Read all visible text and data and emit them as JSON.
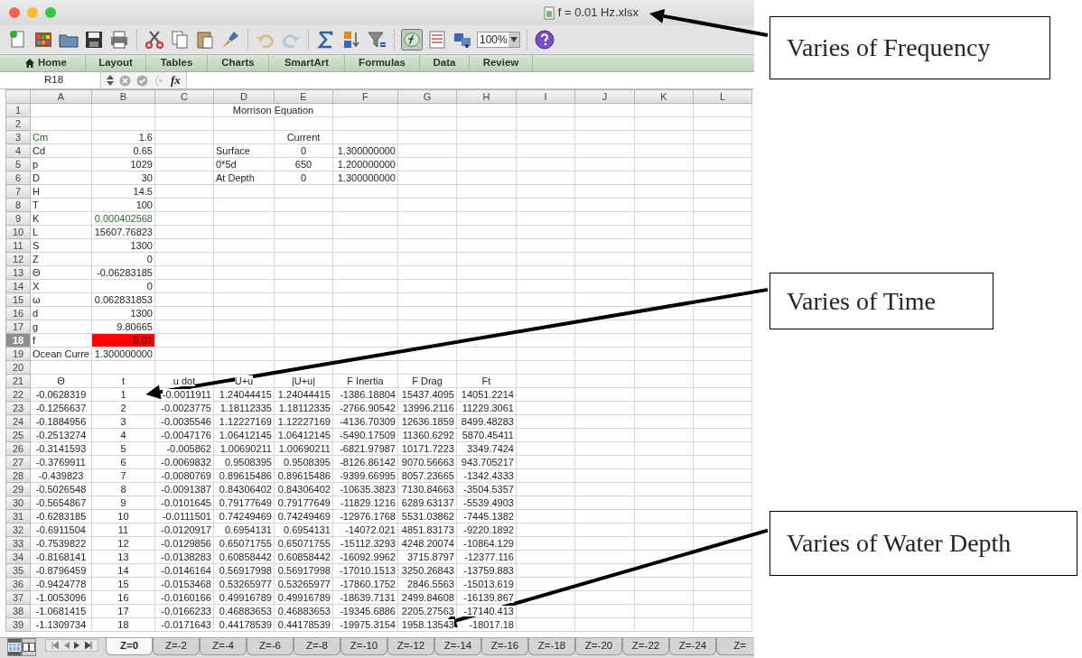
{
  "window": {
    "title": "f = 0.01 Hz.xlsx"
  },
  "toolbar": {
    "zoom": "100%"
  },
  "ribbon_tabs": [
    {
      "label": "Home"
    },
    {
      "label": "Layout"
    },
    {
      "label": "Tables"
    },
    {
      "label": "Charts"
    },
    {
      "label": "SmartArt"
    },
    {
      "label": "Formulas"
    },
    {
      "label": "Data"
    },
    {
      "label": "Review"
    }
  ],
  "formula_bar": {
    "name_box": "R18",
    "fx_label": "fx"
  },
  "columns": [
    "A",
    "B",
    "C",
    "D",
    "E",
    "F",
    "G",
    "H",
    "I",
    "J",
    "K",
    "L"
  ],
  "rows": [
    {
      "number": "1",
      "selected": false,
      "cells": {
        "D": {
          "text": "Morrison Equation",
          "kind": "title"
        }
      }
    },
    {
      "number": "2",
      "selected": false
    },
    {
      "number": "3",
      "selected": false,
      "cells": {
        "A": {
          "text": "Cm",
          "kind": "label",
          "color": "#1e5a1e"
        },
        "B": {
          "text": "1.6",
          "kind": "number"
        },
        "E": {
          "text": "Current",
          "kind": "center"
        }
      }
    },
    {
      "number": "4",
      "selected": false,
      "cells": {
        "A": {
          "text": "Cd",
          "kind": "label"
        },
        "B": {
          "text": "0.65",
          "kind": "number"
        },
        "D": {
          "text": "Surface",
          "kind": "label"
        },
        "E": {
          "text": "0",
          "kind": "center"
        },
        "F": {
          "text": "1.300000000",
          "kind": "number"
        }
      }
    },
    {
      "number": "5",
      "selected": false,
      "cells": {
        "A": {
          "text": "p",
          "kind": "label"
        },
        "B": {
          "text": "1029",
          "kind": "number"
        },
        "D": {
          "text": "0*5d",
          "kind": "label"
        },
        "E": {
          "text": "650",
          "kind": "center"
        },
        "F": {
          "text": "1.200000000",
          "kind": "number"
        }
      }
    },
    {
      "number": "6",
      "selected": false,
      "cells": {
        "A": {
          "text": "D",
          "kind": "label"
        },
        "B": {
          "text": "30",
          "kind": "number"
        },
        "D": {
          "text": "At Depth",
          "kind": "label"
        },
        "E": {
          "text": "0",
          "kind": "center"
        },
        "F": {
          "text": "1.300000000",
          "kind": "number"
        }
      }
    },
    {
      "number": "7",
      "selected": false,
      "cells": {
        "A": {
          "text": "H",
          "kind": "label"
        },
        "B": {
          "text": "14.5",
          "kind": "number"
        }
      }
    },
    {
      "number": "8",
      "selected": false,
      "cells": {
        "A": {
          "text": "T",
          "kind": "label"
        },
        "B": {
          "text": "100",
          "kind": "number"
        }
      }
    },
    {
      "number": "9",
      "selected": false,
      "cells": {
        "A": {
          "text": "K",
          "kind": "label"
        },
        "B": {
          "text": "0.000402568",
          "kind": "number",
          "color": "#2a6e2a"
        }
      }
    },
    {
      "number": "10",
      "selected": false,
      "cells": {
        "A": {
          "text": "L",
          "kind": "label"
        },
        "B": {
          "text": "15607.76823",
          "kind": "number"
        }
      }
    },
    {
      "number": "11",
      "selected": false,
      "cells": {
        "A": {
          "text": "S",
          "kind": "label"
        },
        "B": {
          "text": "1300",
          "kind": "number"
        }
      }
    },
    {
      "number": "12",
      "selected": false,
      "cells": {
        "A": {
          "text": "Z",
          "kind": "label"
        },
        "B": {
          "text": "0",
          "kind": "number"
        }
      }
    },
    {
      "number": "13",
      "selected": false,
      "cells": {
        "A": {
          "text": "Θ",
          "kind": "label"
        },
        "B": {
          "text": "-0.06283185",
          "kind": "number"
        }
      }
    },
    {
      "number": "14",
      "selected": false,
      "cells": {
        "A": {
          "text": "X",
          "kind": "label"
        },
        "B": {
          "text": "0",
          "kind": "number"
        }
      }
    },
    {
      "number": "15",
      "selected": false,
      "cells": {
        "A": {
          "text": "ω",
          "kind": "label"
        },
        "B": {
          "text": "0.062831853",
          "kind": "number"
        }
      }
    },
    {
      "number": "16",
      "selected": false,
      "cells": {
        "A": {
          "text": "d",
          "kind": "label"
        },
        "B": {
          "text": "1300",
          "kind": "number"
        }
      }
    },
    {
      "number": "17",
      "selected": false,
      "cells": {
        "A": {
          "text": "g",
          "kind": "label"
        },
        "B": {
          "text": "9.80665",
          "kind": "number"
        }
      }
    },
    {
      "number": "18",
      "selected": true,
      "cells": {
        "A": {
          "text": "f",
          "kind": "label"
        },
        "B": {
          "text": "0.01",
          "kind": "number",
          "highlighted": true
        }
      }
    },
    {
      "number": "19",
      "selected": false,
      "cells": {
        "A": {
          "text": "Ocean Curre",
          "kind": "label"
        },
        "B": {
          "text": "1.300000000",
          "kind": "number"
        }
      }
    },
    {
      "number": "20",
      "selected": false
    },
    {
      "number": "21",
      "selected": false,
      "cells": {
        "A": {
          "text": "Θ",
          "kind": "center"
        },
        "B": {
          "text": "t",
          "kind": "center"
        },
        "C": {
          "text": "u dot",
          "kind": "center"
        },
        "D": {
          "text": "U+u",
          "kind": "center"
        },
        "E": {
          "text": "|U+u|",
          "kind": "center"
        },
        "F": {
          "text": "F Inertia",
          "kind": "center"
        },
        "G": {
          "text": "F Drag",
          "kind": "center"
        },
        "H": {
          "text": "Ft",
          "kind": "center"
        }
      }
    },
    {
      "number": "22",
      "selected": false,
      "cells": {
        "A": {
          "text": "-0.0628319",
          "kind": "center"
        },
        "B": {
          "text": "1",
          "kind": "center"
        },
        "C": {
          "text": "-0.0011911",
          "kind": "number"
        },
        "D": {
          "text": "1.24044415",
          "kind": "number"
        },
        "E": {
          "text": "1.24044415",
          "kind": "number"
        },
        "F": {
          "text": "-1386.18804",
          "kind": "number"
        },
        "G": {
          "text": "15437.4095",
          "kind": "number"
        },
        "H": {
          "text": "14051.2214",
          "kind": "number"
        }
      }
    },
    {
      "number": "23",
      "selected": false,
      "cells": {
        "A": {
          "text": "-0.1256637",
          "kind": "center"
        },
        "B": {
          "text": "2",
          "kind": "center"
        },
        "C": {
          "text": "-0.0023775",
          "kind": "number"
        },
        "D": {
          "text": "1.18112335",
          "kind": "number"
        },
        "E": {
          "text": "1.18112335",
          "kind": "number"
        },
        "F": {
          "text": "-2766.90542",
          "kind": "number"
        },
        "G": {
          "text": "13996.2116",
          "kind": "number"
        },
        "H": {
          "text": "11229.3061",
          "kind": "number"
        }
      }
    },
    {
      "number": "24",
      "selected": false,
      "cells": {
        "A": {
          "text": "-0.1884956",
          "kind": "center"
        },
        "B": {
          "text": "3",
          "kind": "center"
        },
        "C": {
          "text": "-0.0035546",
          "kind": "number"
        },
        "D": {
          "text": "1.12227169",
          "kind": "number"
        },
        "E": {
          "text": "1.12227169",
          "kind": "number"
        },
        "F": {
          "text": "-4136.70309",
          "kind": "number"
        },
        "G": {
          "text": "12636.1859",
          "kind": "number"
        },
        "H": {
          "text": "8499.48283",
          "kind": "number"
        }
      }
    },
    {
      "number": "25",
      "selected": false,
      "cells": {
        "A": {
          "text": "-0.2513274",
          "kind": "center"
        },
        "B": {
          "text": "4",
          "kind": "center"
        },
        "C": {
          "text": "-0.0047176",
          "kind": "number"
        },
        "D": {
          "text": "1.06412145",
          "kind": "number"
        },
        "E": {
          "text": "1.06412145",
          "kind": "number"
        },
        "F": {
          "text": "-5490.17509",
          "kind": "number"
        },
        "G": {
          "text": "11360.6292",
          "kind": "number"
        },
        "H": {
          "text": "5870.45411",
          "kind": "number"
        }
      }
    },
    {
      "number": "26",
      "selected": false,
      "cells": {
        "A": {
          "text": "-0.3141593",
          "kind": "center"
        },
        "B": {
          "text": "5",
          "kind": "center"
        },
        "C": {
          "text": "-0.005862",
          "kind": "number"
        },
        "D": {
          "text": "1.00690211",
          "kind": "number"
        },
        "E": {
          "text": "1.00690211",
          "kind": "number"
        },
        "F": {
          "text": "-6821.97987",
          "kind": "number"
        },
        "G": {
          "text": "10171.7223",
          "kind": "number"
        },
        "H": {
          "text": "3349.7424",
          "kind": "number"
        }
      }
    },
    {
      "number": "27",
      "selected": false,
      "cells": {
        "A": {
          "text": "-0.3769911",
          "kind": "center"
        },
        "B": {
          "text": "6",
          "kind": "center"
        },
        "C": {
          "text": "-0.0069832",
          "kind": "number"
        },
        "D": {
          "text": "0.9508395",
          "kind": "number"
        },
        "E": {
          "text": "0.9508395",
          "kind": "number"
        },
        "F": {
          "text": "-8126.86142",
          "kind": "number"
        },
        "G": {
          "text": "9070.56663",
          "kind": "number"
        },
        "H": {
          "text": "943.705217",
          "kind": "number"
        }
      }
    },
    {
      "number": "28",
      "selected": false,
      "cells": {
        "A": {
          "text": "-0.439823",
          "kind": "center"
        },
        "B": {
          "text": "7",
          "kind": "center"
        },
        "C": {
          "text": "-0.0080769",
          "kind": "number"
        },
        "D": {
          "text": "0.89615486",
          "kind": "number"
        },
        "E": {
          "text": "0.89615486",
          "kind": "number"
        },
        "F": {
          "text": "-9399.66995",
          "kind": "number"
        },
        "G": {
          "text": "8057.23665",
          "kind": "number"
        },
        "H": {
          "text": "-1342.4333",
          "kind": "number"
        }
      }
    },
    {
      "number": "29",
      "selected": false,
      "cells": {
        "A": {
          "text": "-0.5026548",
          "kind": "center"
        },
        "B": {
          "text": "8",
          "kind": "center"
        },
        "C": {
          "text": "-0.0091387",
          "kind": "number"
        },
        "D": {
          "text": "0.84306402",
          "kind": "number"
        },
        "E": {
          "text": "0.84306402",
          "kind": "number"
        },
        "F": {
          "text": "-10635.3823",
          "kind": "number"
        },
        "G": {
          "text": "7130.84663",
          "kind": "number"
        },
        "H": {
          "text": "-3504.5357",
          "kind": "number"
        }
      }
    },
    {
      "number": "30",
      "selected": false,
      "cells": {
        "A": {
          "text": "-0.5654867",
          "kind": "center"
        },
        "B": {
          "text": "9",
          "kind": "center"
        },
        "C": {
          "text": "-0.0101645",
          "kind": "number"
        },
        "D": {
          "text": "0.79177649",
          "kind": "number"
        },
        "E": {
          "text": "0.79177649",
          "kind": "number"
        },
        "F": {
          "text": "-11829.1216",
          "kind": "number"
        },
        "G": {
          "text": "6289.63137",
          "kind": "number"
        },
        "H": {
          "text": "-5539.4903",
          "kind": "number"
        }
      }
    },
    {
      "number": "31",
      "selected": false,
      "cells": {
        "A": {
          "text": "-0.6283185",
          "kind": "center"
        },
        "B": {
          "text": "10",
          "kind": "center"
        },
        "C": {
          "text": "-0.0111501",
          "kind": "number"
        },
        "D": {
          "text": "0.74249469",
          "kind": "number"
        },
        "E": {
          "text": "0.74249469",
          "kind": "number"
        },
        "F": {
          "text": "-12976.1768",
          "kind": "number"
        },
        "G": {
          "text": "5531.03862",
          "kind": "number"
        },
        "H": {
          "text": "-7445.1382",
          "kind": "number"
        }
      }
    },
    {
      "number": "32",
      "selected": false,
      "cells": {
        "A": {
          "text": "-0.6911504",
          "kind": "center"
        },
        "B": {
          "text": "11",
          "kind": "center"
        },
        "C": {
          "text": "-0.0120917",
          "kind": "number"
        },
        "D": {
          "text": "0.6954131",
          "kind": "number"
        },
        "E": {
          "text": "0.6954131",
          "kind": "number"
        },
        "F": {
          "text": "-14072.021",
          "kind": "number"
        },
        "G": {
          "text": "4851.83173",
          "kind": "number"
        },
        "H": {
          "text": "-9220.1892",
          "kind": "number"
        }
      }
    },
    {
      "number": "33",
      "selected": false,
      "cells": {
        "A": {
          "text": "-0.7539822",
          "kind": "center"
        },
        "B": {
          "text": "12",
          "kind": "center"
        },
        "C": {
          "text": "-0.0129856",
          "kind": "number"
        },
        "D": {
          "text": "0.65071755",
          "kind": "number"
        },
        "E": {
          "text": "0.65071755",
          "kind": "number"
        },
        "F": {
          "text": "-15112.3293",
          "kind": "number"
        },
        "G": {
          "text": "4248.20074",
          "kind": "number"
        },
        "H": {
          "text": "-10864.129",
          "kind": "number"
        }
      }
    },
    {
      "number": "34",
      "selected": false,
      "cells": {
        "A": {
          "text": "-0.8168141",
          "kind": "center"
        },
        "B": {
          "text": "13",
          "kind": "center"
        },
        "C": {
          "text": "-0.0138283",
          "kind": "number"
        },
        "D": {
          "text": "0.60858442",
          "kind": "number"
        },
        "E": {
          "text": "0.60858442",
          "kind": "number"
        },
        "F": {
          "text": "-16092.9962",
          "kind": "number"
        },
        "G": {
          "text": "3715.8797",
          "kind": "number"
        },
        "H": {
          "text": "-12377.116",
          "kind": "number"
        }
      }
    },
    {
      "number": "35",
      "selected": false,
      "cells": {
        "A": {
          "text": "-0.8796459",
          "kind": "center"
        },
        "B": {
          "text": "14",
          "kind": "center"
        },
        "C": {
          "text": "-0.0146164",
          "kind": "number"
        },
        "D": {
          "text": "0.56917998",
          "kind": "number"
        },
        "E": {
          "text": "0.56917998",
          "kind": "number"
        },
        "F": {
          "text": "-17010.1513",
          "kind": "number"
        },
        "G": {
          "text": "3250.26843",
          "kind": "number"
        },
        "H": {
          "text": "-13759.883",
          "kind": "number"
        }
      }
    },
    {
      "number": "36",
      "selected": false,
      "cells": {
        "A": {
          "text": "-0.9424778",
          "kind": "center"
        },
        "B": {
          "text": "15",
          "kind": "center"
        },
        "C": {
          "text": "-0.0153468",
          "kind": "number"
        },
        "D": {
          "text": "0.53265977",
          "kind": "number"
        },
        "E": {
          "text": "0.53265977",
          "kind": "number"
        },
        "F": {
          "text": "-17860.1752",
          "kind": "number"
        },
        "G": {
          "text": "2846.5563",
          "kind": "number"
        },
        "H": {
          "text": "-15013.619",
          "kind": "number"
        }
      }
    },
    {
      "number": "37",
      "selected": false,
      "cells": {
        "A": {
          "text": "-1.0053096",
          "kind": "center"
        },
        "B": {
          "text": "16",
          "kind": "center"
        },
        "C": {
          "text": "-0.0160166",
          "kind": "number"
        },
        "D": {
          "text": "0.49916789",
          "kind": "number"
        },
        "E": {
          "text": "0.49916789",
          "kind": "number"
        },
        "F": {
          "text": "-18639.7131",
          "kind": "number"
        },
        "G": {
          "text": "2499.84608",
          "kind": "number"
        },
        "H": {
          "text": "-16139.867",
          "kind": "number"
        }
      }
    },
    {
      "number": "38",
      "selected": false,
      "cells": {
        "A": {
          "text": "-1.0681415",
          "kind": "center"
        },
        "B": {
          "text": "17",
          "kind": "center"
        },
        "C": {
          "text": "-0.0166233",
          "kind": "number"
        },
        "D": {
          "text": "0.46883653",
          "kind": "number"
        },
        "E": {
          "text": "0.46883653",
          "kind": "number"
        },
        "F": {
          "text": "-19345.6886",
          "kind": "number"
        },
        "G": {
          "text": "2205.27563",
          "kind": "number"
        },
        "H": {
          "text": "-17140.413",
          "kind": "number"
        }
      }
    },
    {
      "number": "39",
      "selected": false,
      "cells": {
        "A": {
          "text": "-1.1309734",
          "kind": "center"
        },
        "B": {
          "text": "18",
          "kind": "center"
        },
        "C": {
          "text": "-0.0171643",
          "kind": "number"
        },
        "D": {
          "text": "0.44178539",
          "kind": "number"
        },
        "E": {
          "text": "0.44178539",
          "kind": "number"
        },
        "F": {
          "text": "-19975.3154",
          "kind": "number"
        },
        "G": {
          "text": "1958.13543",
          "kind": "number"
        },
        "H": {
          "text": "-18017.18",
          "kind": "number"
        }
      }
    }
  ],
  "sheet_tabs": [
    {
      "label": "Z=0",
      "selected": true
    },
    {
      "label": "Z=-2",
      "selected": false
    },
    {
      "label": "Z=-4",
      "selected": false
    },
    {
      "label": "Z=-6",
      "selected": false
    },
    {
      "label": "Z=-8",
      "selected": false
    },
    {
      "label": "Z=-10",
      "selected": false
    },
    {
      "label": "Z=-12",
      "selected": false
    },
    {
      "label": "Z=-14",
      "selected": false
    },
    {
      "label": "Z=-16",
      "selected": false
    },
    {
      "label": "Z=-18",
      "selected": false
    },
    {
      "label": "Z=-20",
      "selected": false
    },
    {
      "label": "Z=-22",
      "selected": false
    },
    {
      "label": "Z=-24",
      "selected": false
    },
    {
      "label": "Z=",
      "selected": false
    }
  ],
  "annotations": [
    {
      "text": "Varies of Frequency"
    },
    {
      "text": "Varies of Time"
    },
    {
      "text": "Varies of Water Depth"
    }
  ]
}
